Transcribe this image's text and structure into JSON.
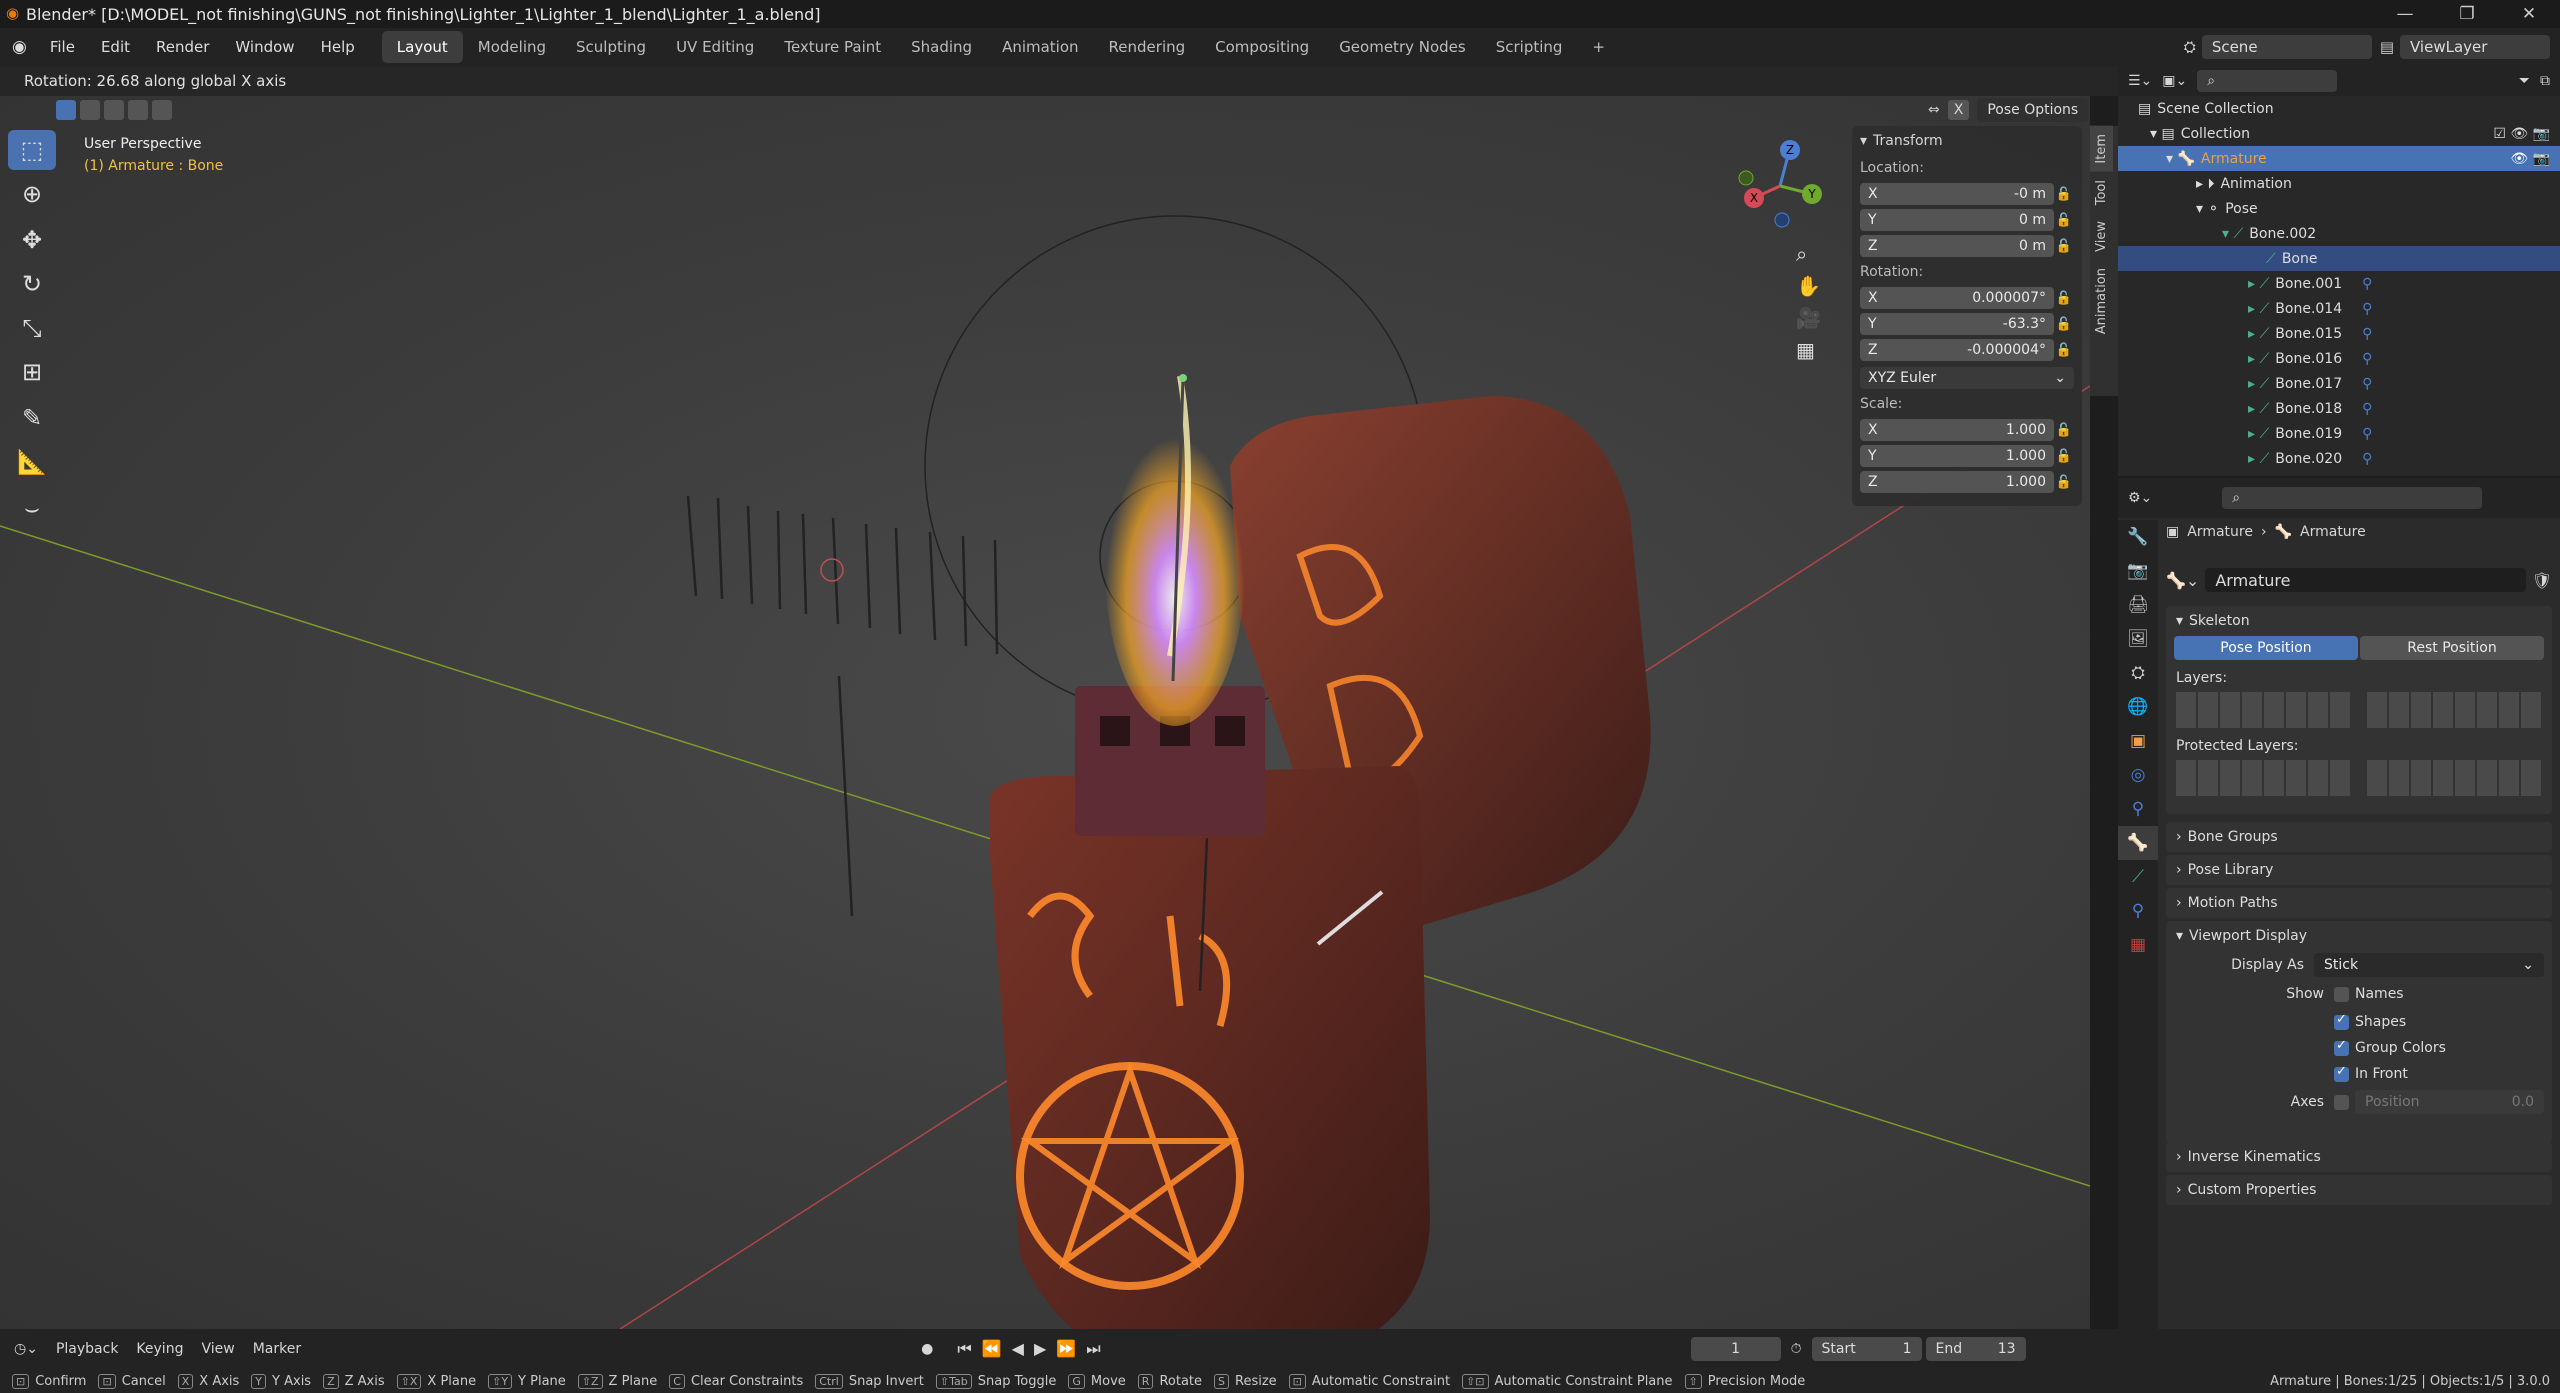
{
  "window": {
    "title": "Blender* [D:\\MODEL_not finishing\\GUNS_not finishing\\Lighter_1\\Lighter_1_blend\\Lighter_1_a.blend]",
    "minimize": "—",
    "maximize": "❐",
    "close": "✕"
  },
  "menu": {
    "items": [
      "File",
      "Edit",
      "Render",
      "Window",
      "Help"
    ],
    "workspaces": [
      "Layout",
      "Modeling",
      "Sculpting",
      "UV Editing",
      "Texture Paint",
      "Shading",
      "Animation",
      "Rendering",
      "Compositing",
      "Geometry Nodes",
      "Scripting"
    ],
    "add_tab": "+",
    "scene": "Scene",
    "view_layer": "ViewLayer"
  },
  "header_status": "Rotation: 26.68 along global X axis",
  "viewport": {
    "perspective": "User Perspective",
    "object_info": "(1) Armature : Bone",
    "pose_options": "Pose Options",
    "x_toggle": "X",
    "gizmo_axes": {
      "x": "X",
      "y": "Y",
      "z": "Z"
    }
  },
  "npanel": {
    "title": "Transform",
    "location_label": "Location:",
    "location": [
      {
        "axis": "X",
        "value": "-0 m"
      },
      {
        "axis": "Y",
        "value": "0 m"
      },
      {
        "axis": "Z",
        "value": "0 m"
      }
    ],
    "rotation_label": "Rotation:",
    "rotation": [
      {
        "axis": "X",
        "value": "0.000007°"
      },
      {
        "axis": "Y",
        "value": "-63.3°"
      },
      {
        "axis": "Z",
        "value": "-0.000004°"
      }
    ],
    "rotation_mode": "XYZ Euler",
    "scale_label": "Scale:",
    "scale": [
      {
        "axis": "X",
        "value": "1.000"
      },
      {
        "axis": "Y",
        "value": "1.000"
      },
      {
        "axis": "Z",
        "value": "1.000"
      }
    ],
    "tabs": [
      "Item",
      "Tool",
      "View",
      "Animation"
    ]
  },
  "outliner": {
    "rows": [
      {
        "label": "Scene Collection",
        "indent": 0
      },
      {
        "label": "Collection",
        "indent": 1
      },
      {
        "label": "Armature",
        "indent": 2
      },
      {
        "label": "Animation",
        "indent": 3
      },
      {
        "label": "Pose",
        "indent": 3
      },
      {
        "label": "Bone.002",
        "indent": 4
      },
      {
        "label": "Bone",
        "indent": 5
      },
      {
        "label": "Bone.001",
        "indent": 5
      },
      {
        "label": "Bone.014",
        "indent": 5
      },
      {
        "label": "Bone.015",
        "indent": 5
      },
      {
        "label": "Bone.016",
        "indent": 5
      },
      {
        "label": "Bone.017",
        "indent": 5
      },
      {
        "label": "Bone.018",
        "indent": 5
      },
      {
        "label": "Bone.019",
        "indent": 5
      },
      {
        "label": "Bone.020",
        "indent": 5
      }
    ]
  },
  "properties": {
    "breadcrumb_1": "Armature",
    "breadcrumb_2": "Armature",
    "data_name": "Armature",
    "skeleton_title": "Skeleton",
    "pose_position": "Pose Position",
    "rest_position": "Rest Position",
    "layers_label": "Layers:",
    "protected_layers_label": "Protected Layers:",
    "collapsed_panels_1": [
      "Bone Groups",
      "Pose Library",
      "Motion Paths"
    ],
    "viewport_display_title": "Viewport Display",
    "display_as_label": "Display As",
    "display_as_value": "Stick",
    "show_label": "Show",
    "show_options": [
      {
        "label": "Names",
        "checked": false
      },
      {
        "label": "Shapes",
        "checked": true
      },
      {
        "label": "Group Colors",
        "checked": true
      },
      {
        "label": "In Front",
        "checked": true
      }
    ],
    "axes_label": "Axes",
    "axes_position_label": "Position",
    "axes_position_value": "0.0",
    "collapsed_panels_2": [
      "Inverse Kinematics",
      "Custom Properties"
    ]
  },
  "timeline": {
    "playback": "Playback",
    "keying": "Keying",
    "view": "View",
    "marker": "Marker",
    "current_frame": "1",
    "start_label": "Start",
    "start": "1",
    "end_label": "End",
    "end": "13"
  },
  "statusbar": {
    "hints": [
      {
        "key": "⊡",
        "label": "Confirm"
      },
      {
        "key": "⊡",
        "label": "Cancel"
      },
      {
        "key": "X",
        "label": "X Axis"
      },
      {
        "key": "Y",
        "label": "Y Axis"
      },
      {
        "key": "Z",
        "label": "Z Axis"
      },
      {
        "key": "⇧X",
        "label": "X Plane"
      },
      {
        "key": "⇧Y",
        "label": "Y Plane"
      },
      {
        "key": "⇧Z",
        "label": "Z Plane"
      },
      {
        "key": "C",
        "label": "Clear Constraints"
      },
      {
        "key": "Ctrl",
        "label": "Snap Invert"
      },
      {
        "key": "⇧Tab",
        "label": "Snap Toggle"
      },
      {
        "key": "G",
        "label": "Move"
      },
      {
        "key": "R",
        "label": "Rotate"
      },
      {
        "key": "S",
        "label": "Resize"
      },
      {
        "key": "⊡",
        "label": "Automatic Constraint"
      },
      {
        "key": "⇧⊡",
        "label": "Automatic Constraint Plane"
      },
      {
        "key": "⇧",
        "label": "Precision Mode"
      }
    ],
    "info": "Armature | Bones:1/25 | Objects:1/5 | 3.0.0"
  }
}
